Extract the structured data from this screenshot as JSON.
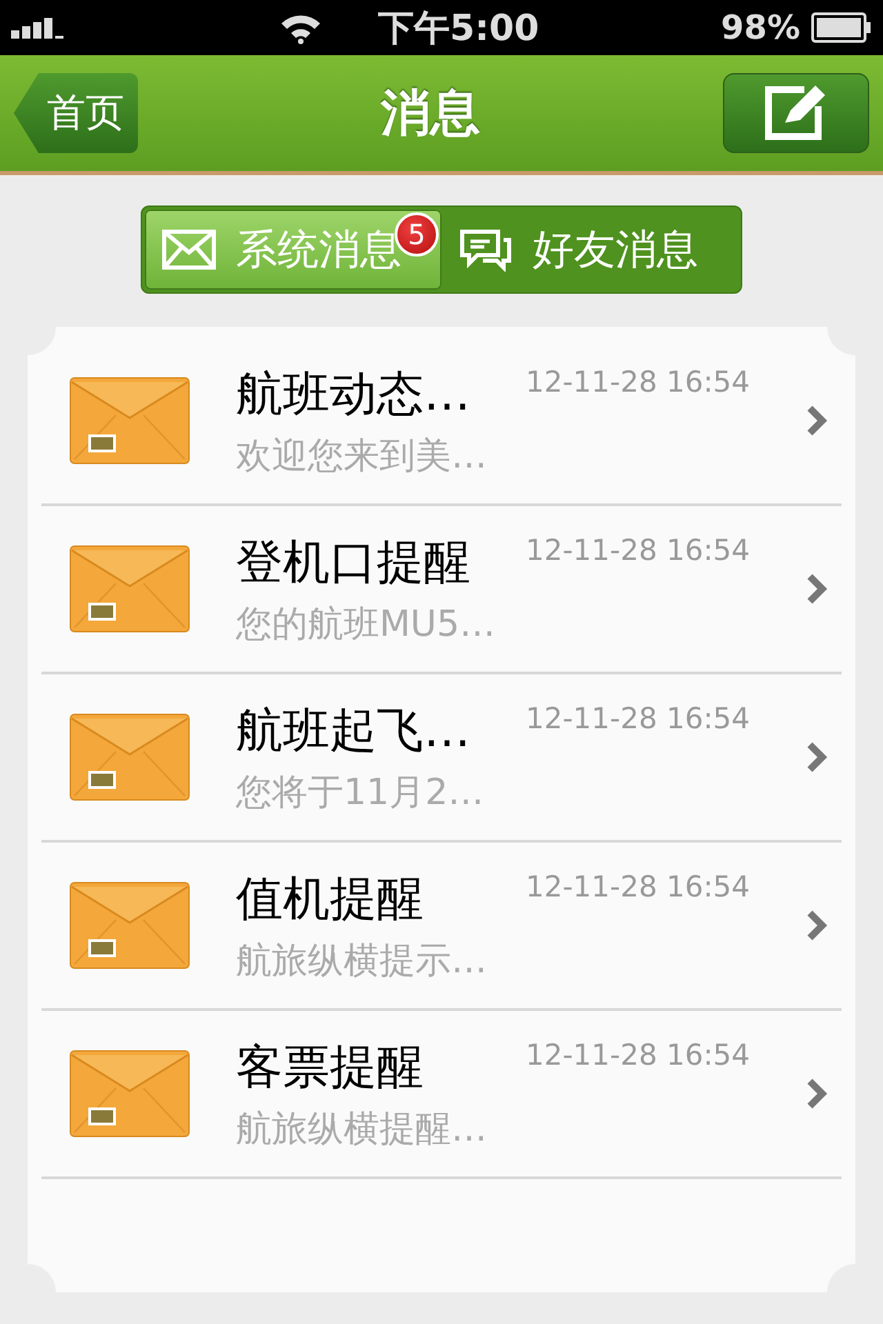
{
  "status_bar": {
    "time": "下午5:00",
    "battery": "98%"
  },
  "nav": {
    "back": "首页",
    "title": "消息"
  },
  "tabs": [
    {
      "label": "系统消息",
      "selected": true,
      "badge": "5"
    },
    {
      "label": "好友消息",
      "selected": false
    }
  ],
  "messages": [
    {
      "title": "航班动态…",
      "time": "12-11-28 16:54",
      "preview": "欢迎您来到美…"
    },
    {
      "title": "登机口提醒",
      "time": "12-11-28 16:54",
      "preview": "您的航班MU5…"
    },
    {
      "title": "航班起飞…",
      "time": "12-11-28 16:54",
      "preview": "您将于11月2…"
    },
    {
      "title": "值机提醒",
      "time": "12-11-28 16:54",
      "preview": "航旅纵横提示…"
    },
    {
      "title": "客票提醒",
      "time": "12-11-28 16:54",
      "preview": "航旅纵横提醒…"
    }
  ]
}
